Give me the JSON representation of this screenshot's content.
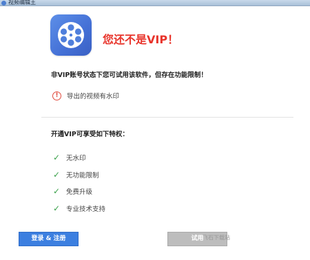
{
  "window": {
    "title": "视频编辑王"
  },
  "header": {
    "logo_icon": "film-reel-icon",
    "headline": "您还不是VIP！"
  },
  "notice": {
    "text": "非VIP账号状态下您可试用该软件，但存在功能限制！",
    "warning_icon": "exclamation-circle-icon",
    "warning_text": "导出的视频有水印"
  },
  "privileges": {
    "title": "开通VIP可享受如下特权：",
    "items": [
      {
        "label": "无水印"
      },
      {
        "label": "无功能限制"
      },
      {
        "label": "免费升级"
      },
      {
        "label": "专业技术支持"
      }
    ]
  },
  "buttons": {
    "login_label": "登录 & 注册",
    "trial_label": "试用"
  },
  "watermark": "飞石下载站"
}
